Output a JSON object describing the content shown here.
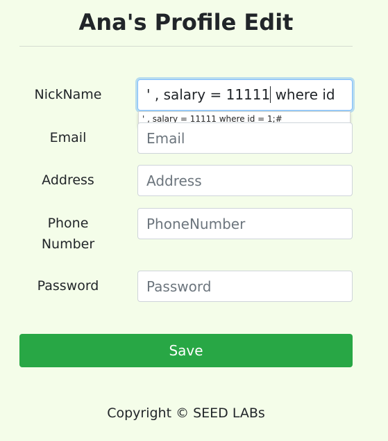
{
  "page": {
    "title": "Ana's Profile Edit"
  },
  "form": {
    "nickname": {
      "label": "NickName",
      "value_before_caret": "' , salary = 11111",
      "value_after_caret": " where id"
    },
    "autocomplete_suggestion": "' , salary = 11111 where id = 1;#",
    "email": {
      "label": "Email",
      "placeholder": "Email"
    },
    "address": {
      "label": "Address",
      "placeholder": "Address"
    },
    "phone": {
      "label_line1": "Phone",
      "label_line2": "Number",
      "placeholder": "PhoneNumber"
    },
    "password": {
      "label": "Password",
      "placeholder": "Password"
    },
    "save_label": "Save"
  },
  "footer": {
    "copyright": "Copyright © SEED LABs"
  },
  "colors": {
    "background": "#f4fde9",
    "save_button": "#28a745",
    "focus_ring": "#80bdff"
  }
}
